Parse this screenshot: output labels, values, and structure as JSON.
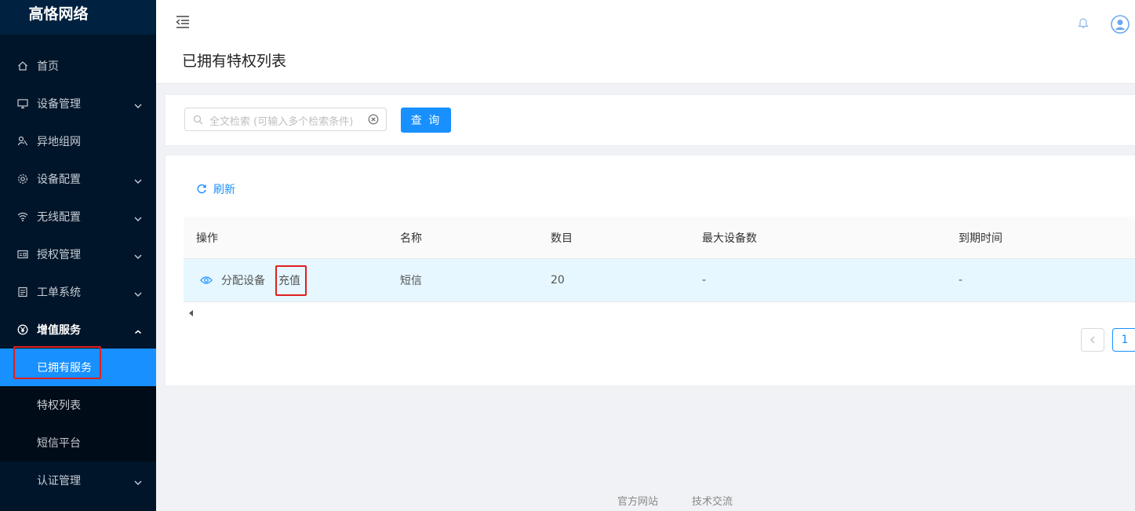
{
  "app": {
    "title": "高恪网络"
  },
  "sidebar": {
    "items": [
      {
        "label": "首页",
        "icon": "home-icon"
      },
      {
        "label": "设备管理",
        "icon": "monitor-icon"
      },
      {
        "label": "异地组网",
        "icon": "network-icon"
      },
      {
        "label": "设备配置",
        "icon": "gear-icon"
      },
      {
        "label": "无线配置",
        "icon": "wifi-icon"
      },
      {
        "label": "授权管理",
        "icon": "id-card-icon"
      },
      {
        "label": "工单系统",
        "icon": "ticket-icon"
      },
      {
        "label": "增值服务",
        "icon": "yen-icon"
      },
      {
        "label": "认证管理",
        "icon": "auth-icon"
      }
    ],
    "submenu": [
      {
        "label": "已拥有服务",
        "active": true
      },
      {
        "label": "特权列表"
      },
      {
        "label": "短信平台"
      }
    ]
  },
  "page": {
    "title": "已拥有特权列表"
  },
  "search": {
    "placeholder": "全文检索 (可输入多个检索条件)",
    "button_label": "查 询"
  },
  "toolbar": {
    "refresh_label": "刷新"
  },
  "table": {
    "columns": [
      "操作",
      "名称",
      "数目",
      "最大设备数",
      "到期时间"
    ],
    "rows": [
      {
        "action_assign": "分配设备",
        "action_recharge": "充值",
        "name": "短信",
        "count": "20",
        "max_devices": "-",
        "expire": "-"
      }
    ]
  },
  "pagination": {
    "current": "1"
  },
  "footer": {
    "links": [
      "官方网站",
      "技术交流"
    ]
  },
  "colors": {
    "primary": "#1890ff",
    "sidebar": "#00152a",
    "highlight": "#e02020",
    "success": "#52c41a"
  }
}
